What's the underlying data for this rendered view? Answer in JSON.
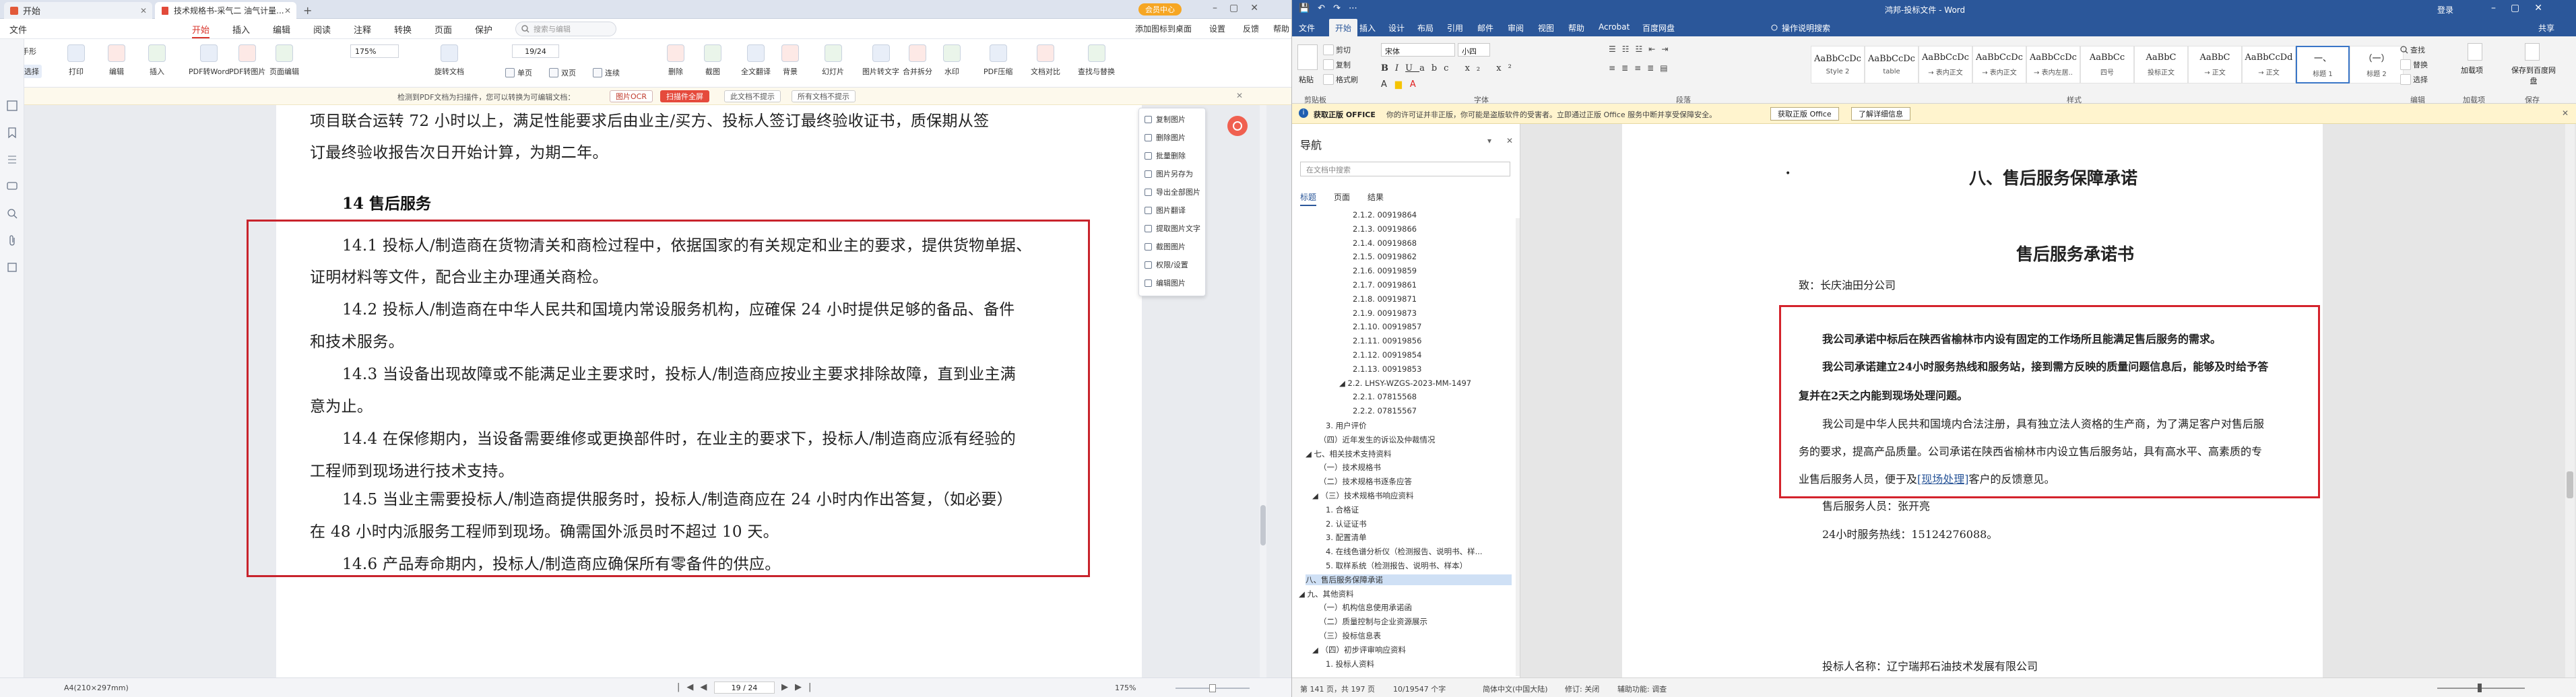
{
  "pdf": {
    "tabs": [
      {
        "label": "开始"
      },
      {
        "label": "技术规格书-采气二 油气计量..."
      }
    ],
    "vip_badge": "会员中心",
    "menu": [
      "文件",
      "开始",
      "插入",
      "编辑",
      "阅读",
      "注释",
      "转换",
      "页面",
      "保护"
    ],
    "menu_active": "开始",
    "search_placeholder": "搜索与编辑",
    "right_tools": [
      "添加图标到桌面",
      "设置",
      "反馈",
      "帮助"
    ],
    "ribbon_small": [
      "手形",
      "选择"
    ],
    "ribbon_buttons": [
      "打印",
      "编辑",
      "插入",
      "PDF转Word",
      "PDF转图片",
      "页面编辑",
      "",
      "旋转文档",
      "",
      "",
      "删除",
      "截图",
      "全文翻译",
      "背景",
      "幻灯片",
      "图片转文字",
      "合并拆分",
      "水印",
      "PDF压缩",
      "文档对比",
      "查找与替换"
    ],
    "zoom": "175%",
    "page_input": "19/24",
    "view_labels": [
      "单页",
      "双页",
      "连续"
    ],
    "notice": "检测到PDF文档为扫描件，您可以转换为可编辑文档：",
    "notice_chips": [
      "图片OCR",
      "扫描件全屏",
      "此文档不提示",
      "所有文档不提示"
    ],
    "context_menu": [
      "复制图片",
      "删除图片",
      "批量删除",
      "图片另存为",
      "导出全部图片",
      "图片翻译",
      "提取图片文字",
      "截图图片",
      "权限/设置",
      "编辑图片"
    ],
    "page": {
      "intro_line1": "项目联合运转 72 小时以上，满足性能要求后由业主/买方、投标人签订最终验收证书，质保期从签",
      "intro_line2": "订最终验收报告次日开始计算，为期二年。",
      "heading": "14 售后服务",
      "lines": [
        "14.1 投标人/制造商在货物清关和商检过程中，依据国家的有关规定和业主的要求，提供货物单据、",
        "证明材料等文件，配合业主办理通关商检。",
        "14.2  投标人/制造商在中华人民共和国境内常设服务机构，应確保 24 小时提供足够的备品、备件",
        "和技术服务。",
        "14.3 当设备出现故障或不能满足业主要求时，投标人/制造商应按业主要求排除故障，直到业主满",
        "意为止。",
        "14.4 在保修期内，当设备需要维修或更换部件时，在业主的要求下，投标人/制造商应派有经验的",
        "工程师到现场进行技术支持。",
        "14.5  当业主需要投标人/制造商提供服务时，投标人/制造商应在 24 小时内作出答复，（如必要）",
        "在 48 小时内派服务工程师到现场。确需国外派员时不超过 10 天。",
        "14.6  产品寿命期内，投标人/制造商应确保所有零备件的供应。"
      ]
    },
    "status": {
      "size": "A4(210×297mm)",
      "page": "19 / 24",
      "zoom": "175%"
    }
  },
  "word": {
    "title": "鸿邦-投标文件 - Word",
    "user": "登录",
    "menu": [
      "文件",
      "开始",
      "插入",
      "设计",
      "布局",
      "引用",
      "邮件",
      "审阅",
      "视图",
      "帮助",
      "Acrobat",
      "百度网盘"
    ],
    "menu_active": "开始",
    "tell_me": "操作说明搜索",
    "share": "共享",
    "ribbon_groups": [
      "剪贴板",
      "字体",
      "段落",
      "样式",
      "编辑",
      "加载项",
      "保存"
    ],
    "font_name": "宋体",
    "font_size": "小四",
    "clipboard": [
      "粘贴",
      "剪切",
      "复制",
      "格式刷"
    ],
    "styles": [
      {
        "preview": "AaBbCcDc",
        "name": "Style 2"
      },
      {
        "preview": "AaBbCcDc",
        "name": "table"
      },
      {
        "preview": "AaBbCcDc",
        "name": "→ 表内正文"
      },
      {
        "preview": "AaBbCcDc",
        "name": "→ 表内正文"
      },
      {
        "preview": "AaBbCcDc",
        "name": "→ 表内左居.."
      },
      {
        "preview": "AaBbCc",
        "name": "四号"
      },
      {
        "preview": "AaBbC",
        "name": "投标正文"
      },
      {
        "preview": "AaBbC",
        "name": "→ 正文"
      },
      {
        "preview": "AaBbCcDd",
        "name": "→ 正文"
      },
      {
        "preview": "一、",
        "name": "标题 1"
      },
      {
        "preview": "（一）",
        "name": "标题 2"
      }
    ],
    "editing": [
      "查找",
      "替换",
      "选择"
    ],
    "addins": [
      "加载项"
    ],
    "save": [
      "保存到百度网盘"
    ],
    "notice_label": "获取正版 OFFICE",
    "notice_text": "你的许可证并非正版，你可能是盗版软件的受害者。立即通过正版 Office 服务中断并享受保障安全。",
    "notice_buttons": [
      "获取正版 Office",
      "了解详细信息"
    ],
    "nav": {
      "title": "导航",
      "search_placeholder": "在文档中搜索",
      "tabs": [
        "标题",
        "页面",
        "结果"
      ],
      "tab_active": "标题",
      "items": [
        {
          "text": "2.1.2. 00919864",
          "indent": 90
        },
        {
          "text": "2.1.3. 00919866",
          "indent": 90
        },
        {
          "text": "2.1.4. 00919868",
          "indent": 90
        },
        {
          "text": "2.1.5. 00919862",
          "indent": 90
        },
        {
          "text": "2.1.6. 00919859",
          "indent": 90
        },
        {
          "text": "2.1.7. 00919861",
          "indent": 90
        },
        {
          "text": "2.1.8. 00919871",
          "indent": 90
        },
        {
          "text": "2.1.9. 00919873",
          "indent": 90
        },
        {
          "text": "2.1.10. 00919857",
          "indent": 90
        },
        {
          "text": "2.1.11. 00919856",
          "indent": 90
        },
        {
          "text": "2.1.12. 00919854",
          "indent": 90
        },
        {
          "text": "2.1.13. 00919853",
          "indent": 90
        },
        {
          "text": "◢ 2.2. LHSY-WZGS-2023-MM-1497",
          "indent": 70
        },
        {
          "text": "2.2.1. 07815568",
          "indent": 90
        },
        {
          "text": "2.2.2. 07815567",
          "indent": 90
        },
        {
          "text": "3. 用户评价",
          "indent": 50
        },
        {
          "text": "（四）近年发生的诉讼及仲裁情况",
          "indent": 40
        },
        {
          "text": "◢ 七、相关技术支持资料",
          "indent": 20
        },
        {
          "text": "（一）技术规格书",
          "indent": 40
        },
        {
          "text": "（二）技术规格书逐条应答",
          "indent": 40
        },
        {
          "text": "◢ （三）技术规格书响应资料",
          "indent": 30
        },
        {
          "text": "1. 合格证",
          "indent": 50
        },
        {
          "text": "2. 认证证书",
          "indent": 50
        },
        {
          "text": "3. 配置清单",
          "indent": 50
        },
        {
          "text": "4. 在线色谱分析仪（检测报告、说明书、样...",
          "indent": 50
        },
        {
          "text": "5. 取样系统（检测报告、说明书、样本）",
          "indent": 50
        },
        {
          "text": "八、售后服务保障承诺",
          "indent": 20,
          "sel": true
        },
        {
          "text": "◢ 九、其他资料",
          "indent": 10
        },
        {
          "text": "（一）机构信息使用承诺函",
          "indent": 40
        },
        {
          "text": "（二）质量控制与企业资源展示",
          "indent": 40
        },
        {
          "text": "（三）投标信息表",
          "indent": 40
        },
        {
          "text": "◢ （四）初步评审响应资料",
          "indent": 30
        },
        {
          "text": "1. 投标人资料",
          "indent": 50
        }
      ]
    },
    "doc": {
      "heading": "八、售后服务保障承诺",
      "subheading": "售后服务承诺书",
      "addressee": "致：长庆油田分公司",
      "bold1": "我公司承诺中标后在陕西省榆林市内设有固定的工作场所且能满足售后服务的需求。",
      "bold2a": "我公司承诺建立24小时服务热线和服务站，接到需方反映的质量问题信息后，能够及时给予答",
      "bold2b": "复并在2天之内能到现场处理问题。",
      "para1a": "我公司是中华人民共和国境内合法注册，具有独立法人资格的生产商，为了满足客户对售后服",
      "para1b": "务的要求，提高产品质量。公司承诺在陕西省榆林市内设立售后服务站，具有高水平、高素质的专",
      "para1c": "业售后服务人员，便于及",
      "para1link": "[现场处理]",
      "para1d": "客户的反馈意见。",
      "contact_person": "售后服务人员：张开亮",
      "hotline": "24小时服务热线：15124276088。",
      "bidder": "投标人名称：辽宁瑞邦石油技术发展有限公司"
    },
    "status": {
      "page": "第 141 页，共 197 页",
      "words": "10/19547 个字",
      "lang": "简体中文(中国大陆)",
      "track": "修订: 关闭",
      "access": "辅助功能: 调查"
    }
  }
}
